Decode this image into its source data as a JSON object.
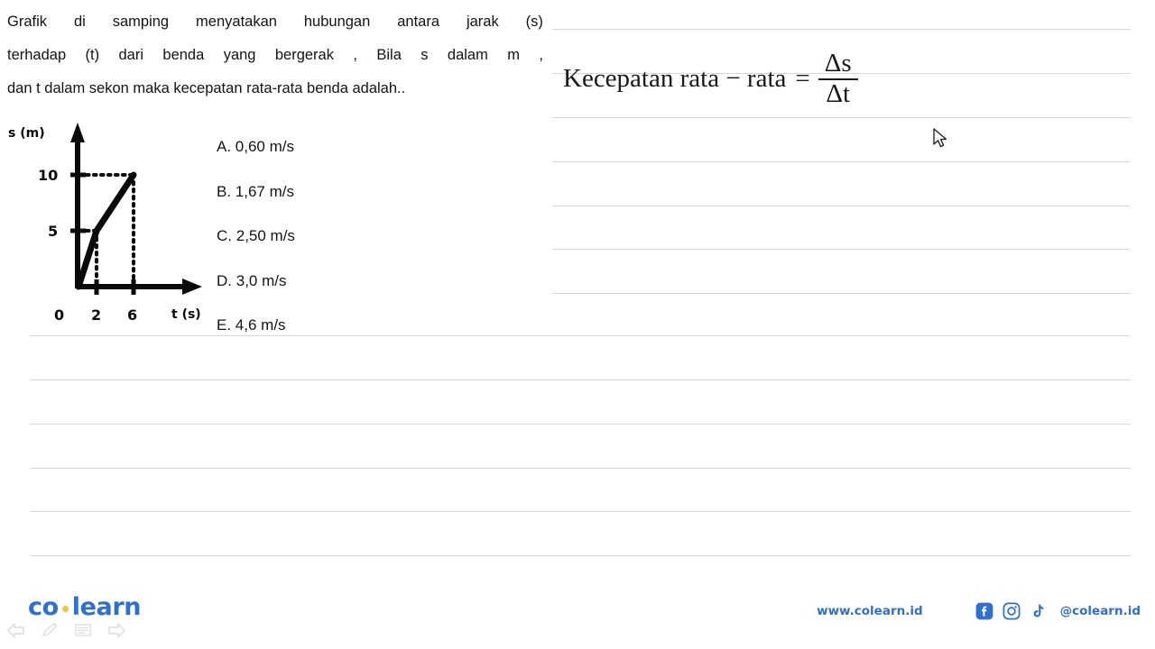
{
  "question": {
    "lines": [
      [
        "Grafik",
        "di",
        "samping",
        "menyatakan",
        "hubungan",
        "antara",
        "jarak",
        "(s)"
      ],
      [
        "terhadap",
        "(t)",
        "dari",
        "benda",
        "yang",
        "bergerak",
        ",",
        "Bila",
        "s",
        "dalam",
        "m",
        ","
      ],
      [
        "dan t dalam sekon maka kecepatan rata-rata benda adalah.."
      ]
    ]
  },
  "graph": {
    "y_axis_label": "s (m)",
    "x_axis_label": "t (s)",
    "origin_label": "0",
    "y_ticks": [
      "10",
      "5"
    ],
    "x_ticks": [
      "2",
      "6"
    ]
  },
  "chart_data": {
    "type": "line",
    "title": "",
    "xlabel": "t (s)",
    "ylabel": "s (m)",
    "x": [
      0,
      2,
      6
    ],
    "values": [
      0,
      5,
      10
    ],
    "xticks": [
      0,
      2,
      6
    ],
    "yticks": [
      5,
      10
    ],
    "xlim": [
      0,
      9
    ],
    "ylim": [
      0,
      12
    ],
    "grid": false,
    "annotations": [
      "dashed guide from (2,5) to axes",
      "dashed guide from (6,10) to axes"
    ],
    "series": [
      {
        "name": "s(t)",
        "points": [
          [
            0,
            0
          ],
          [
            2,
            5
          ],
          [
            6,
            10
          ]
        ]
      }
    ]
  },
  "options": [
    {
      "key": "A.",
      "text": "0,60 m/s"
    },
    {
      "key": "B.",
      "text": "1,67 m/s"
    },
    {
      "key": "C.",
      "text": "2,50 m/s"
    },
    {
      "key": "D.",
      "text": "3,0 m/s"
    },
    {
      "key": "E.",
      "text": "4,6 m/s"
    }
  ],
  "formula": {
    "left": "Kecepatan rata − rata",
    "equals": "=",
    "numerator": "Δs",
    "denominator": "Δt"
  },
  "footer": {
    "logo_first": "co",
    "logo_second": "learn",
    "site_url": "www.colearn.id",
    "handle": "@colearn.id"
  },
  "colors": {
    "brand_blue": "#2f6fd0",
    "logo_dot_yellow": "#f2c53d",
    "rule_grey": "#d7d7d7",
    "ink_black": "#0a0a0a"
  }
}
